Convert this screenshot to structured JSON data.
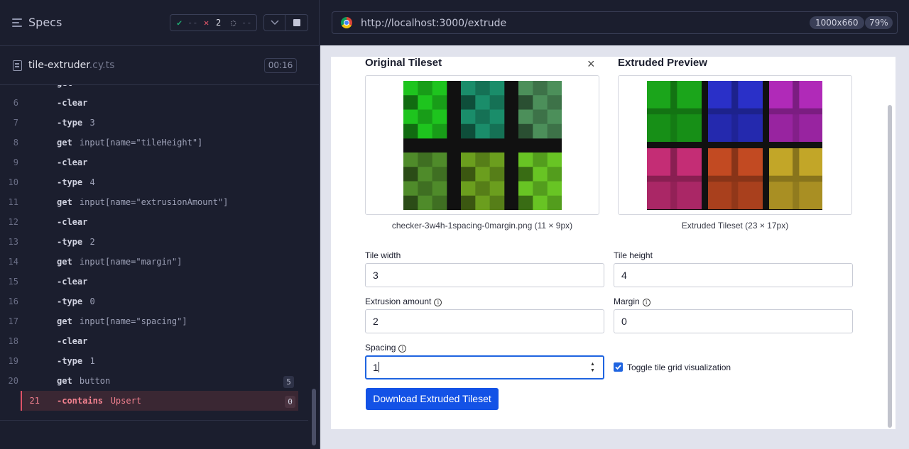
{
  "reporter": {
    "header": {
      "title": "Specs",
      "stats": {
        "passed": "--",
        "failed": "2",
        "pending": "--"
      }
    },
    "spec": {
      "name": "tile-extruder",
      "ext": ".cy.ts",
      "duration": "00:16"
    },
    "commands": [
      {
        "num": "6",
        "name": "-clear",
        "arg": ""
      },
      {
        "num": "7",
        "name": "-type",
        "arg": "3"
      },
      {
        "num": "8",
        "name": "get",
        "arg": "input[name=\"tileHeight\"]"
      },
      {
        "num": "9",
        "name": "-clear",
        "arg": ""
      },
      {
        "num": "10",
        "name": "-type",
        "arg": "4"
      },
      {
        "num": "11",
        "name": "get",
        "arg": "input[name=\"extrusionAmount\"]"
      },
      {
        "num": "12",
        "name": "-clear",
        "arg": ""
      },
      {
        "num": "13",
        "name": "-type",
        "arg": "2"
      },
      {
        "num": "14",
        "name": "get",
        "arg": "input[name=\"margin\"]"
      },
      {
        "num": "15",
        "name": "-clear",
        "arg": ""
      },
      {
        "num": "16",
        "name": "-type",
        "arg": "0"
      },
      {
        "num": "17",
        "name": "get",
        "arg": "input[name=\"spacing\"]"
      },
      {
        "num": "18",
        "name": "-clear",
        "arg": ""
      },
      {
        "num": "19",
        "name": "-type",
        "arg": "1"
      },
      {
        "num": "20",
        "name": "get",
        "arg": "button",
        "badge": "5"
      },
      {
        "num": "21",
        "name": "-contains",
        "arg": "Upsert",
        "badge": "0",
        "failed": true
      }
    ]
  },
  "browser": {
    "url": "http://localhost:3000/extrude",
    "viewport": "1000x660",
    "zoom": "79%"
  },
  "app": {
    "original": {
      "title": "Original Tileset",
      "caption": "checker-3w4h-1spacing-0margin.png (11 × 9px)",
      "tile_colors": [
        [
          "#1ec41e",
          "#1a8d6a",
          "#4c8f5a"
        ],
        [
          "#4f8b2a",
          "#6b9e1e",
          "#68c424"
        ]
      ]
    },
    "extruded": {
      "title": "Extruded Preview",
      "caption": "Extruded Tileset (23 × 17px)",
      "tile_colors": [
        [
          "#1ba51b",
          "#2a30c8",
          "#b02ab8"
        ],
        [
          "#c42d75",
          "#c24a22",
          "#c2a628"
        ]
      ]
    },
    "fields": {
      "tile_width": {
        "label": "Tile width",
        "value": "3"
      },
      "tile_height": {
        "label": "Tile height",
        "value": "4"
      },
      "extrusion": {
        "label": "Extrusion amount",
        "value": "2"
      },
      "margin": {
        "label": "Margin",
        "value": "0"
      },
      "spacing": {
        "label": "Spacing",
        "value": "1"
      }
    },
    "info_glyph": "i",
    "close_glyph": "×",
    "toggle_label": "Toggle tile grid visualization",
    "toggle_checked": true,
    "download_label": "Download Extruded Tileset"
  }
}
